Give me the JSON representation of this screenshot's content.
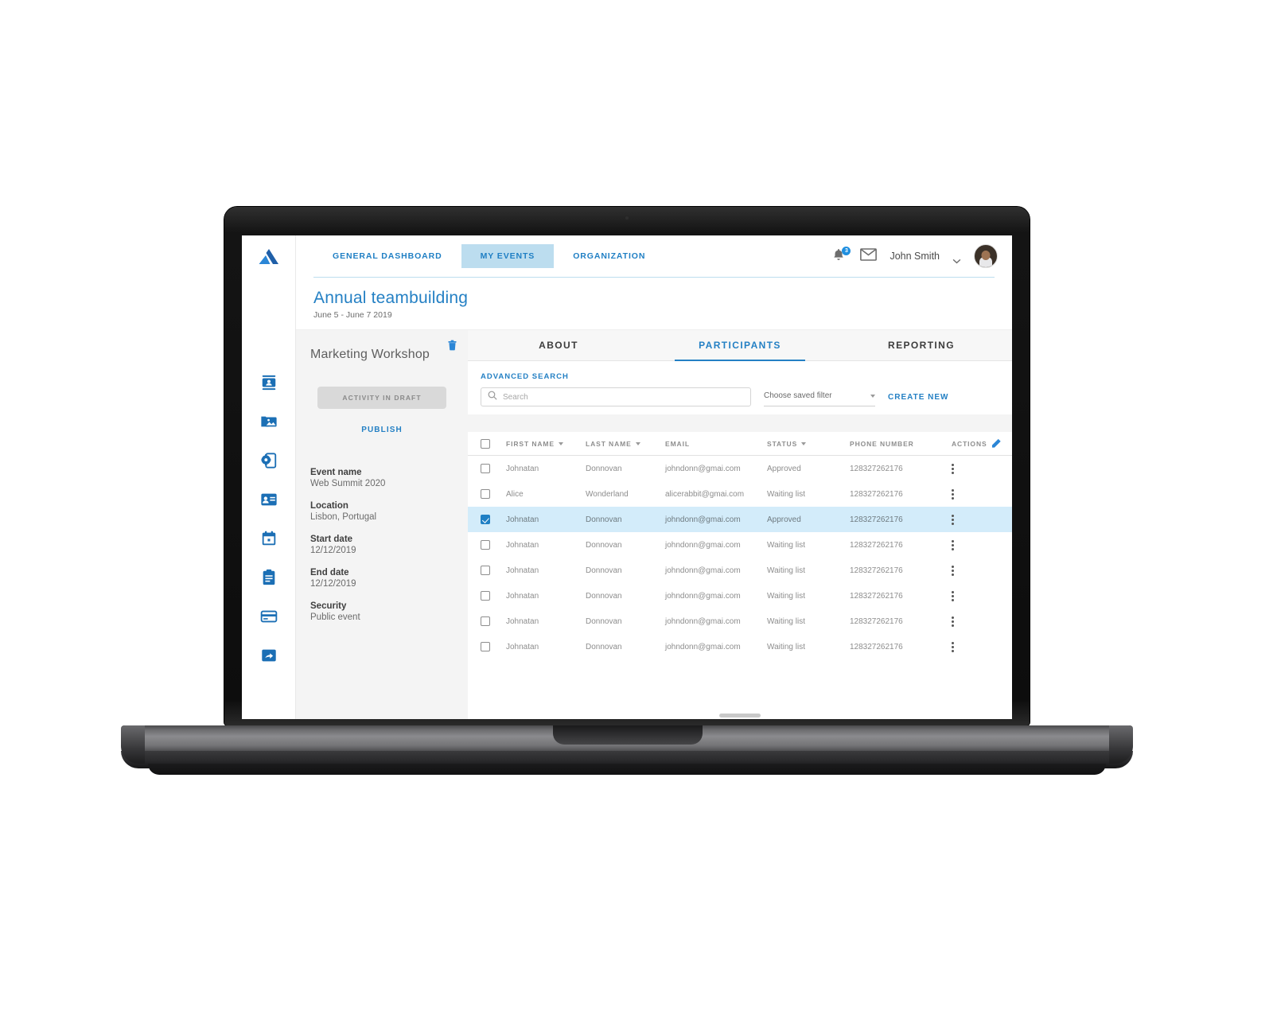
{
  "brand": {
    "logo_name": "company-logo",
    "accent": "#2480c4",
    "accent_light": "#bcddef",
    "selected_row_bg": "#d3ecfa"
  },
  "topnav": {
    "tabs": [
      {
        "label": "GENERAL DASHBOARD",
        "active": false
      },
      {
        "label": "MY EVENTS",
        "active": true
      },
      {
        "label": "ORGANIZATION",
        "active": false
      }
    ],
    "notifications_badge": "3",
    "username": "John Smith"
  },
  "page": {
    "title": "Annual teambuilding",
    "subtitle": "June 5 - June 7 2019"
  },
  "rail": {
    "items": [
      {
        "icon": "contact-card-icon"
      },
      {
        "icon": "photo-folder-icon"
      },
      {
        "icon": "mobile-settings-icon"
      },
      {
        "icon": "id-badge-icon"
      },
      {
        "icon": "calendar-icon"
      },
      {
        "icon": "clipboard-icon"
      },
      {
        "icon": "credit-card-icon"
      },
      {
        "icon": "share-icon"
      }
    ]
  },
  "detail": {
    "title": "Marketing Workshop",
    "delete_icon": "trash-icon",
    "status_chip": "ACTIVITY IN DRAFT",
    "publish_label": "PUBLISH",
    "fields": [
      {
        "label": "Event name",
        "value": "Web Summit 2020"
      },
      {
        "label": "Location",
        "value": "Lisbon, Portugal"
      },
      {
        "label": "Start date",
        "value": "12/12/2019"
      },
      {
        "label": "End date",
        "value": "12/12/2019"
      },
      {
        "label": "Security",
        "value": "Public event"
      }
    ]
  },
  "content": {
    "tabs": [
      {
        "label": "ABOUT",
        "active": false
      },
      {
        "label": "PARTICIPANTS",
        "active": true
      },
      {
        "label": "REPORTING",
        "active": false
      }
    ],
    "toolbar": {
      "advanced_search_label": "ADVANCED SEARCH",
      "search_value": "",
      "search_placeholder": "Search",
      "saved_filter_label": "Choose saved filter",
      "create_new_label": "CREATE NEW"
    },
    "table": {
      "columns": [
        {
          "key": "first_name",
          "label": "FIRST NAME",
          "sortable": true
        },
        {
          "key": "last_name",
          "label": "LAST NAME",
          "sortable": true
        },
        {
          "key": "email",
          "label": "EMAIL",
          "sortable": false
        },
        {
          "key": "status",
          "label": "STATUS",
          "sortable": true
        },
        {
          "key": "phone",
          "label": "PHONE NUMBER",
          "sortable": false
        },
        {
          "key": "actions",
          "label": "ACTIONS",
          "sortable": false
        }
      ],
      "edit_icon": "pencil-icon",
      "rows": [
        {
          "checked": false,
          "first_name": "Johnatan",
          "last_name": "Donnovan",
          "email": "johndonn@gmai.com",
          "status": "Approved",
          "phone": "128327262176"
        },
        {
          "checked": false,
          "first_name": "Alice",
          "last_name": "Wonderland",
          "email": "alicerabbit@gmai.com",
          "status": "Waiting list",
          "phone": "128327262176"
        },
        {
          "checked": true,
          "first_name": "Johnatan",
          "last_name": "Donnovan",
          "email": "johndonn@gmai.com",
          "status": "Approved",
          "phone": "128327262176"
        },
        {
          "checked": false,
          "first_name": "Johnatan",
          "last_name": "Donnovan",
          "email": "johndonn@gmai.com",
          "status": "Waiting list",
          "phone": "128327262176"
        },
        {
          "checked": false,
          "first_name": "Johnatan",
          "last_name": "Donnovan",
          "email": "johndonn@gmai.com",
          "status": "Waiting list",
          "phone": "128327262176"
        },
        {
          "checked": false,
          "first_name": "Johnatan",
          "last_name": "Donnovan",
          "email": "johndonn@gmai.com",
          "status": "Waiting list",
          "phone": "128327262176"
        },
        {
          "checked": false,
          "first_name": "Johnatan",
          "last_name": "Donnovan",
          "email": "johndonn@gmai.com",
          "status": "Waiting list",
          "phone": "128327262176"
        },
        {
          "checked": false,
          "first_name": "Johnatan",
          "last_name": "Donnovan",
          "email": "johndonn@gmai.com",
          "status": "Waiting list",
          "phone": "128327262176"
        }
      ]
    }
  }
}
